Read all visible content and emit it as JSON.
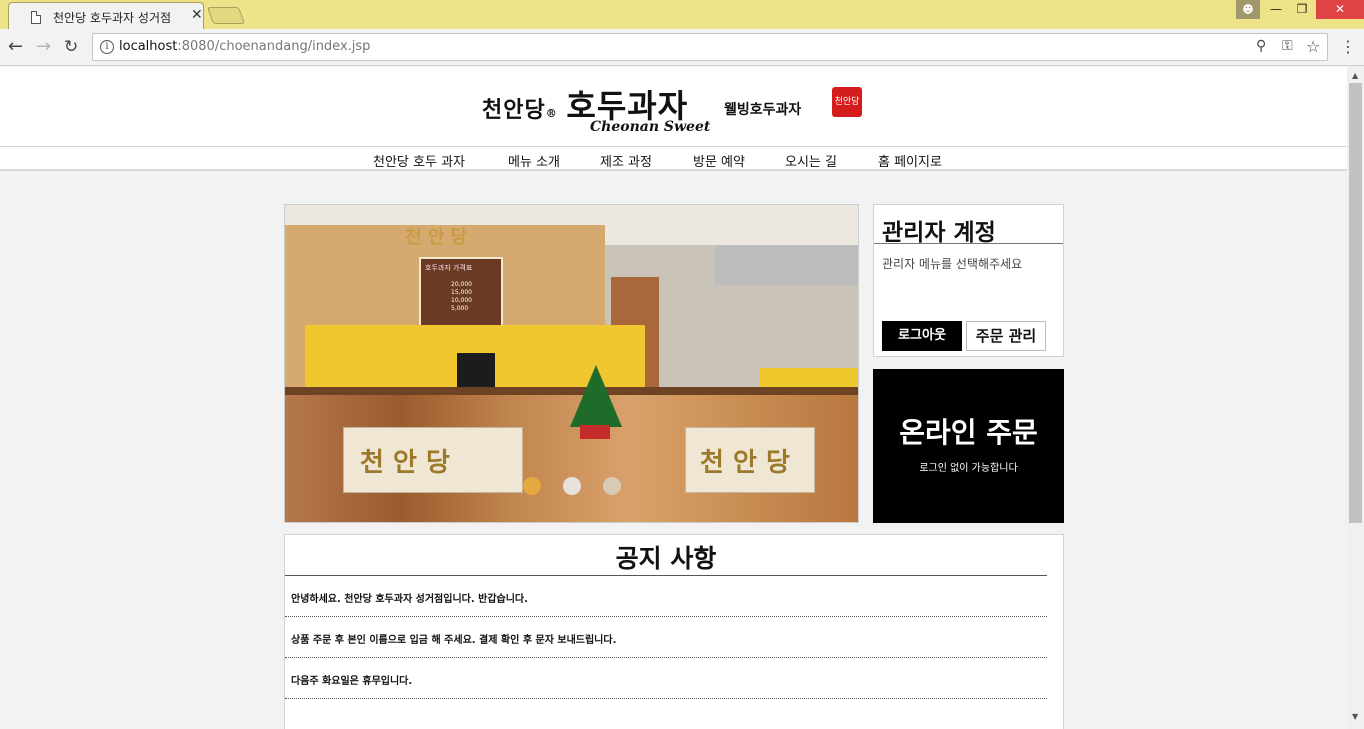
{
  "browser": {
    "tab_title": "천안당 호두과자 성거점",
    "tab_close": "✕",
    "url_host": "localhost",
    "url_path": ":8080/choenandang/index.jsp"
  },
  "header": {
    "logo_main": "천안당",
    "logo_reg": "®",
    "logo_big": "호두과자",
    "logo_sub": "웰빙호두과자",
    "logo_en": "Cheonan Sweet",
    "logo_seal": "천안당"
  },
  "nav": {
    "items": [
      "천안당 호두 과자",
      "메뉴 소개",
      "제조 과정",
      "방문 예약",
      "오시는 길",
      "홈 페이지로"
    ]
  },
  "slider": {
    "top_sign": "천 안 당",
    "poster_title": "호두과자 가격표",
    "poster_prices": "20,000\n15,000\n10,000\n5,000",
    "panel_left": "천 안 당",
    "panel_right": "천 안 당",
    "active_index": 0
  },
  "admin": {
    "title": "관리자 계정",
    "message": "관리자 메뉴를 선택해주세요",
    "logout_label": "로그아웃",
    "orders_label": "주문 관리"
  },
  "order": {
    "title": "온라인 주문",
    "subtitle": "로그인 없이 가능합니다"
  },
  "notice": {
    "title": "공지 사항",
    "items": [
      "안녕하세요. 천안당 호두과자 성거점입니다. 반갑습니다.",
      "상품 주문 후 본인 이름으로 입금 해 주세요. 결제 확인 후 문자 보내드립니다.",
      "다음주 화요일은 휴무입니다."
    ]
  },
  "colors": {
    "titlebar": "#efe38a",
    "accent_dot": "#e5a93f",
    "button_dark": "#000000"
  }
}
